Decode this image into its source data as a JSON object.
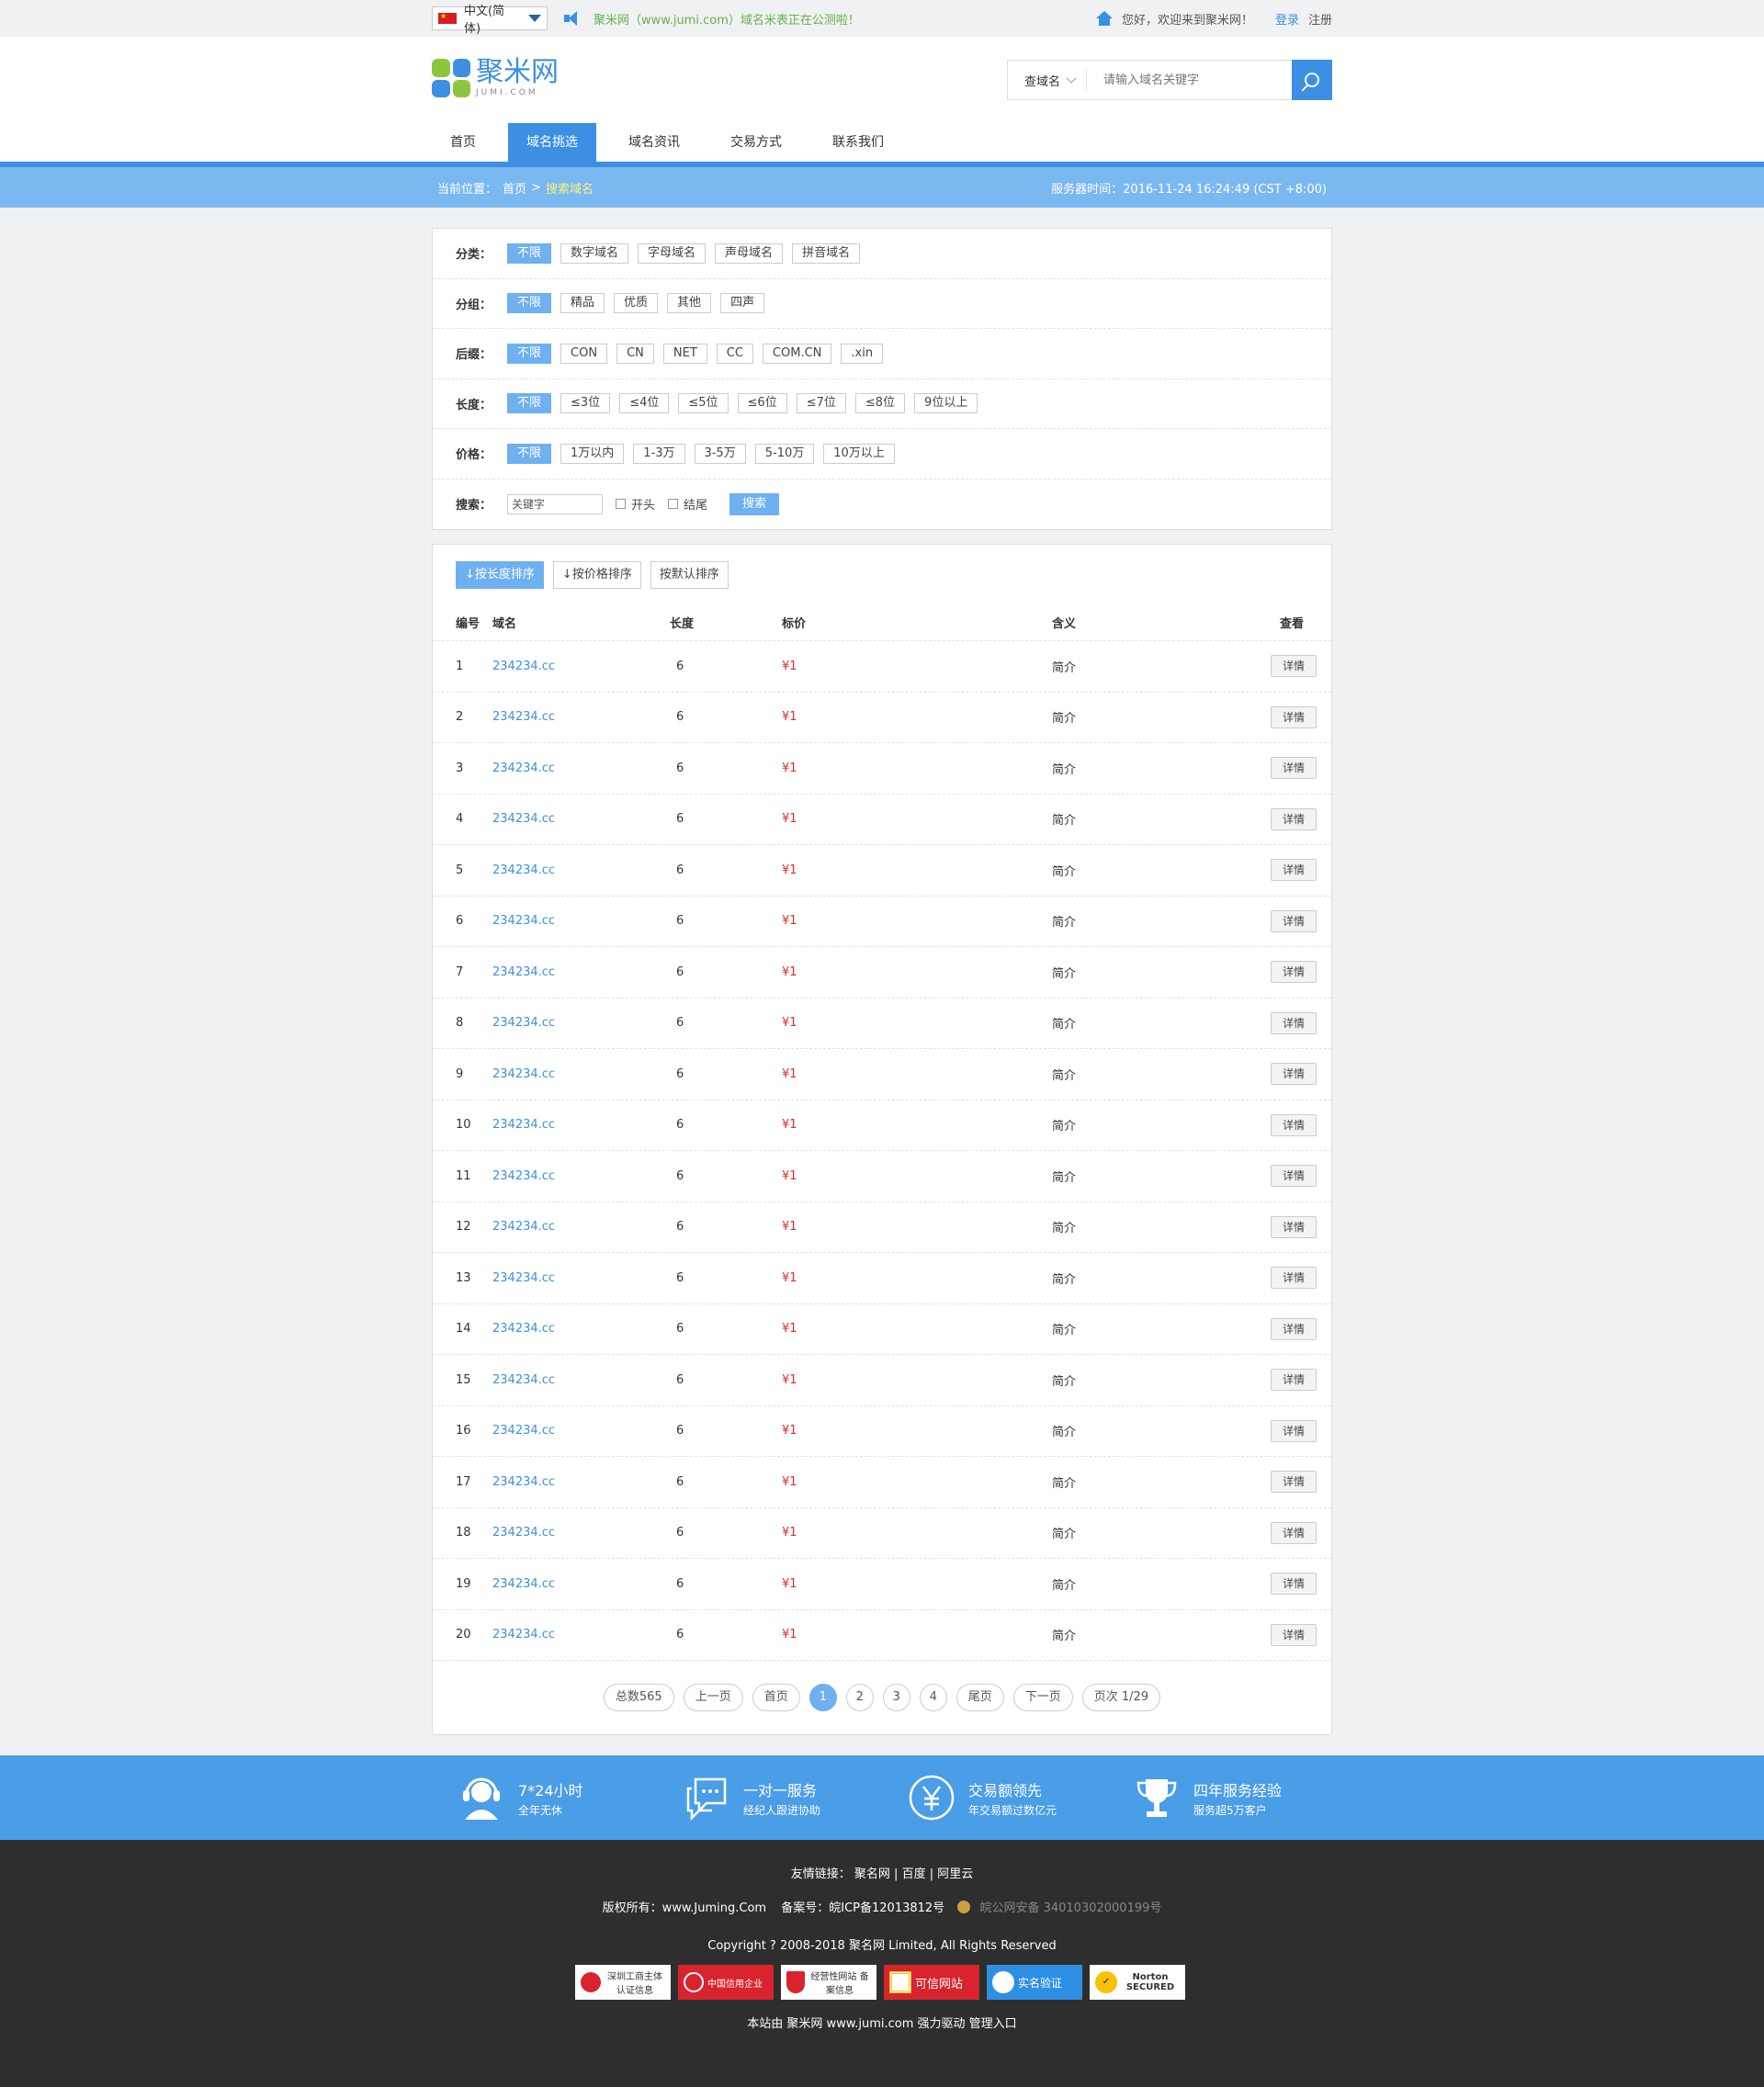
{
  "topbar": {
    "language": "中文(简体)",
    "notice": "聚米网（www.jumi.com）域名米表正在公测啦！",
    "welcome": "您好，欢迎来到聚米网！",
    "login": "登录",
    "register": "注册"
  },
  "header": {
    "logo_text": "聚米网",
    "logo_sub": "JUMI.COM",
    "search_type": "查域名",
    "search_placeholder": "请输入域名关键字",
    "nav": [
      "首页",
      "域名挑选",
      "域名资讯",
      "交易方式",
      "联系我们"
    ],
    "active_nav": "域名挑选"
  },
  "breadcrumb": {
    "label": "当前位置：",
    "home": "首页",
    "sep": ">",
    "current": "搜索域名",
    "server_time": "服务器时间：2016-11-24 16:24:49 (CST +8:00)"
  },
  "filters": {
    "category": {
      "label": "分类：",
      "options": [
        "不限",
        "数字域名",
        "字母域名",
        "声母域名",
        "拼音域名"
      ]
    },
    "group": {
      "label": "分组：",
      "options": [
        "不限",
        "精品",
        "优质",
        "其他",
        "四声"
      ]
    },
    "suffix": {
      "label": "后缀：",
      "options": [
        "不限",
        "CON",
        "CN",
        "NET",
        "CC",
        "COM.CN",
        ".xin"
      ]
    },
    "length": {
      "label": "长度：",
      "options": [
        "不限",
        "≤3位",
        "≤4位",
        "≤5位",
        "≤6位",
        "≤7位",
        "≤8位",
        "9位以上"
      ]
    },
    "price": {
      "label": "价格：",
      "options": [
        "不限",
        "1万以内",
        "1-3万",
        "3-5万",
        "5-10万",
        "10万以上"
      ]
    },
    "search": {
      "label": "搜索：",
      "keyword": "关键字",
      "starts": "开头",
      "ends": "结尾",
      "button": "搜索"
    }
  },
  "sort": [
    "按长度排序",
    "按价格排序",
    "按默认排序"
  ],
  "table": {
    "headers": [
      "编号",
      "域名",
      "长度",
      "标价",
      "含义",
      "查看"
    ],
    "rows": [
      {
        "no": "1",
        "domain": "234234.cc",
        "length": "6",
        "price": "¥1",
        "meaning": "简介",
        "action": "详情"
      },
      {
        "no": "2",
        "domain": "234234.cc",
        "length": "6",
        "price": "¥1",
        "meaning": "简介",
        "action": "详情"
      },
      {
        "no": "3",
        "domain": "234234.cc",
        "length": "6",
        "price": "¥1",
        "meaning": "简介",
        "action": "详情"
      },
      {
        "no": "4",
        "domain": "234234.cc",
        "length": "6",
        "price": "¥1",
        "meaning": "简介",
        "action": "详情"
      },
      {
        "no": "5",
        "domain": "234234.cc",
        "length": "6",
        "price": "¥1",
        "meaning": "简介",
        "action": "详情"
      },
      {
        "no": "6",
        "domain": "234234.cc",
        "length": "6",
        "price": "¥1",
        "meaning": "简介",
        "action": "详情"
      },
      {
        "no": "7",
        "domain": "234234.cc",
        "length": "6",
        "price": "¥1",
        "meaning": "简介",
        "action": "详情"
      },
      {
        "no": "8",
        "domain": "234234.cc",
        "length": "6",
        "price": "¥1",
        "meaning": "简介",
        "action": "详情"
      },
      {
        "no": "9",
        "domain": "234234.cc",
        "length": "6",
        "price": "¥1",
        "meaning": "简介",
        "action": "详情"
      },
      {
        "no": "10",
        "domain": "234234.cc",
        "length": "6",
        "price": "¥1",
        "meaning": "简介",
        "action": "详情"
      },
      {
        "no": "11",
        "domain": "234234.cc",
        "length": "6",
        "price": "¥1",
        "meaning": "简介",
        "action": "详情"
      },
      {
        "no": "12",
        "domain": "234234.cc",
        "length": "6",
        "price": "¥1",
        "meaning": "简介",
        "action": "详情"
      },
      {
        "no": "13",
        "domain": "234234.cc",
        "length": "6",
        "price": "¥1",
        "meaning": "简介",
        "action": "详情"
      },
      {
        "no": "14",
        "domain": "234234.cc",
        "length": "6",
        "price": "¥1",
        "meaning": "简介",
        "action": "详情"
      },
      {
        "no": "15",
        "domain": "234234.cc",
        "length": "6",
        "price": "¥1",
        "meaning": "简介",
        "action": "详情"
      },
      {
        "no": "16",
        "domain": "234234.cc",
        "length": "6",
        "price": "¥1",
        "meaning": "简介",
        "action": "详情"
      },
      {
        "no": "17",
        "domain": "234234.cc",
        "length": "6",
        "price": "¥1",
        "meaning": "简介",
        "action": "详情"
      },
      {
        "no": "18",
        "domain": "234234.cc",
        "length": "6",
        "price": "¥1",
        "meaning": "简介",
        "action": "详情"
      },
      {
        "no": "19",
        "domain": "234234.cc",
        "length": "6",
        "price": "¥1",
        "meaning": "简介",
        "action": "详情"
      },
      {
        "no": "20",
        "domain": "234234.cc",
        "length": "6",
        "price": "¥1",
        "meaning": "简介",
        "action": "详情"
      }
    ]
  },
  "pagination": {
    "total": "总数565",
    "prev": "上一页",
    "first": "首页",
    "pages": [
      "1",
      "2",
      "3",
      "4"
    ],
    "current": "1",
    "last": "尾页",
    "next": "下一页",
    "info": "页次 1/29"
  },
  "services": [
    {
      "icon": "headset-icon",
      "title": "7*24小时",
      "sub": "全年无休"
    },
    {
      "icon": "chat-icon",
      "title": "一对一服务",
      "sub": "经纪人跟进协助"
    },
    {
      "icon": "yen-icon",
      "title": "交易额领先",
      "sub": "年交易额过数亿元"
    },
    {
      "icon": "trophy-icon",
      "title": "四年服务经验",
      "sub": "服务超5万客户"
    }
  ],
  "footer": {
    "links_label": "友情链接：",
    "links": [
      "聚名网",
      "百度",
      "阿里云"
    ],
    "copyright_owner": "版权所有：www.Juming.Com",
    "icp": "备案号：皖ICP备12013812号",
    "police": "皖公网安备 34010302000199号",
    "copyright": "Copyright ? 2008-2018 聚名网 Limited, All Rights Reserved",
    "badges": [
      {
        "icon": "police-badge-icon",
        "text": "深圳工商主体认证信息",
        "bg": "#ffffff",
        "fg": "#333333"
      },
      {
        "icon": "seal-icon",
        "text": "中国信用企业",
        "bg": "#d9232e",
        "fg": "#ffffff"
      },
      {
        "icon": "shield-icon",
        "text": "经营性网站 备案信息",
        "bg": "#ffffff",
        "fg": "#333333"
      },
      {
        "icon": "trust-icon",
        "text": "可信网站",
        "bg": "#d9232e",
        "fg": "#ffffff"
      },
      {
        "icon": "verify-icon",
        "text": "实名验证",
        "bg": "#2d8fe3",
        "fg": "#ffffff"
      },
      {
        "icon": "norton-icon",
        "text": "Norton SECURED",
        "bg": "#ffffff",
        "fg": "#333333"
      }
    ],
    "powered": "本站由 聚米网 www.jumi.com 强力驱动 管理入口"
  },
  "colors": {
    "accent": "#3c8fe3",
    "crumb_bg": "#7ab8f2",
    "tag_active": "#6fb0f0",
    "price": "#e62a2a",
    "notice": "#63b24a",
    "footer_bg": "#2e2e2e"
  }
}
